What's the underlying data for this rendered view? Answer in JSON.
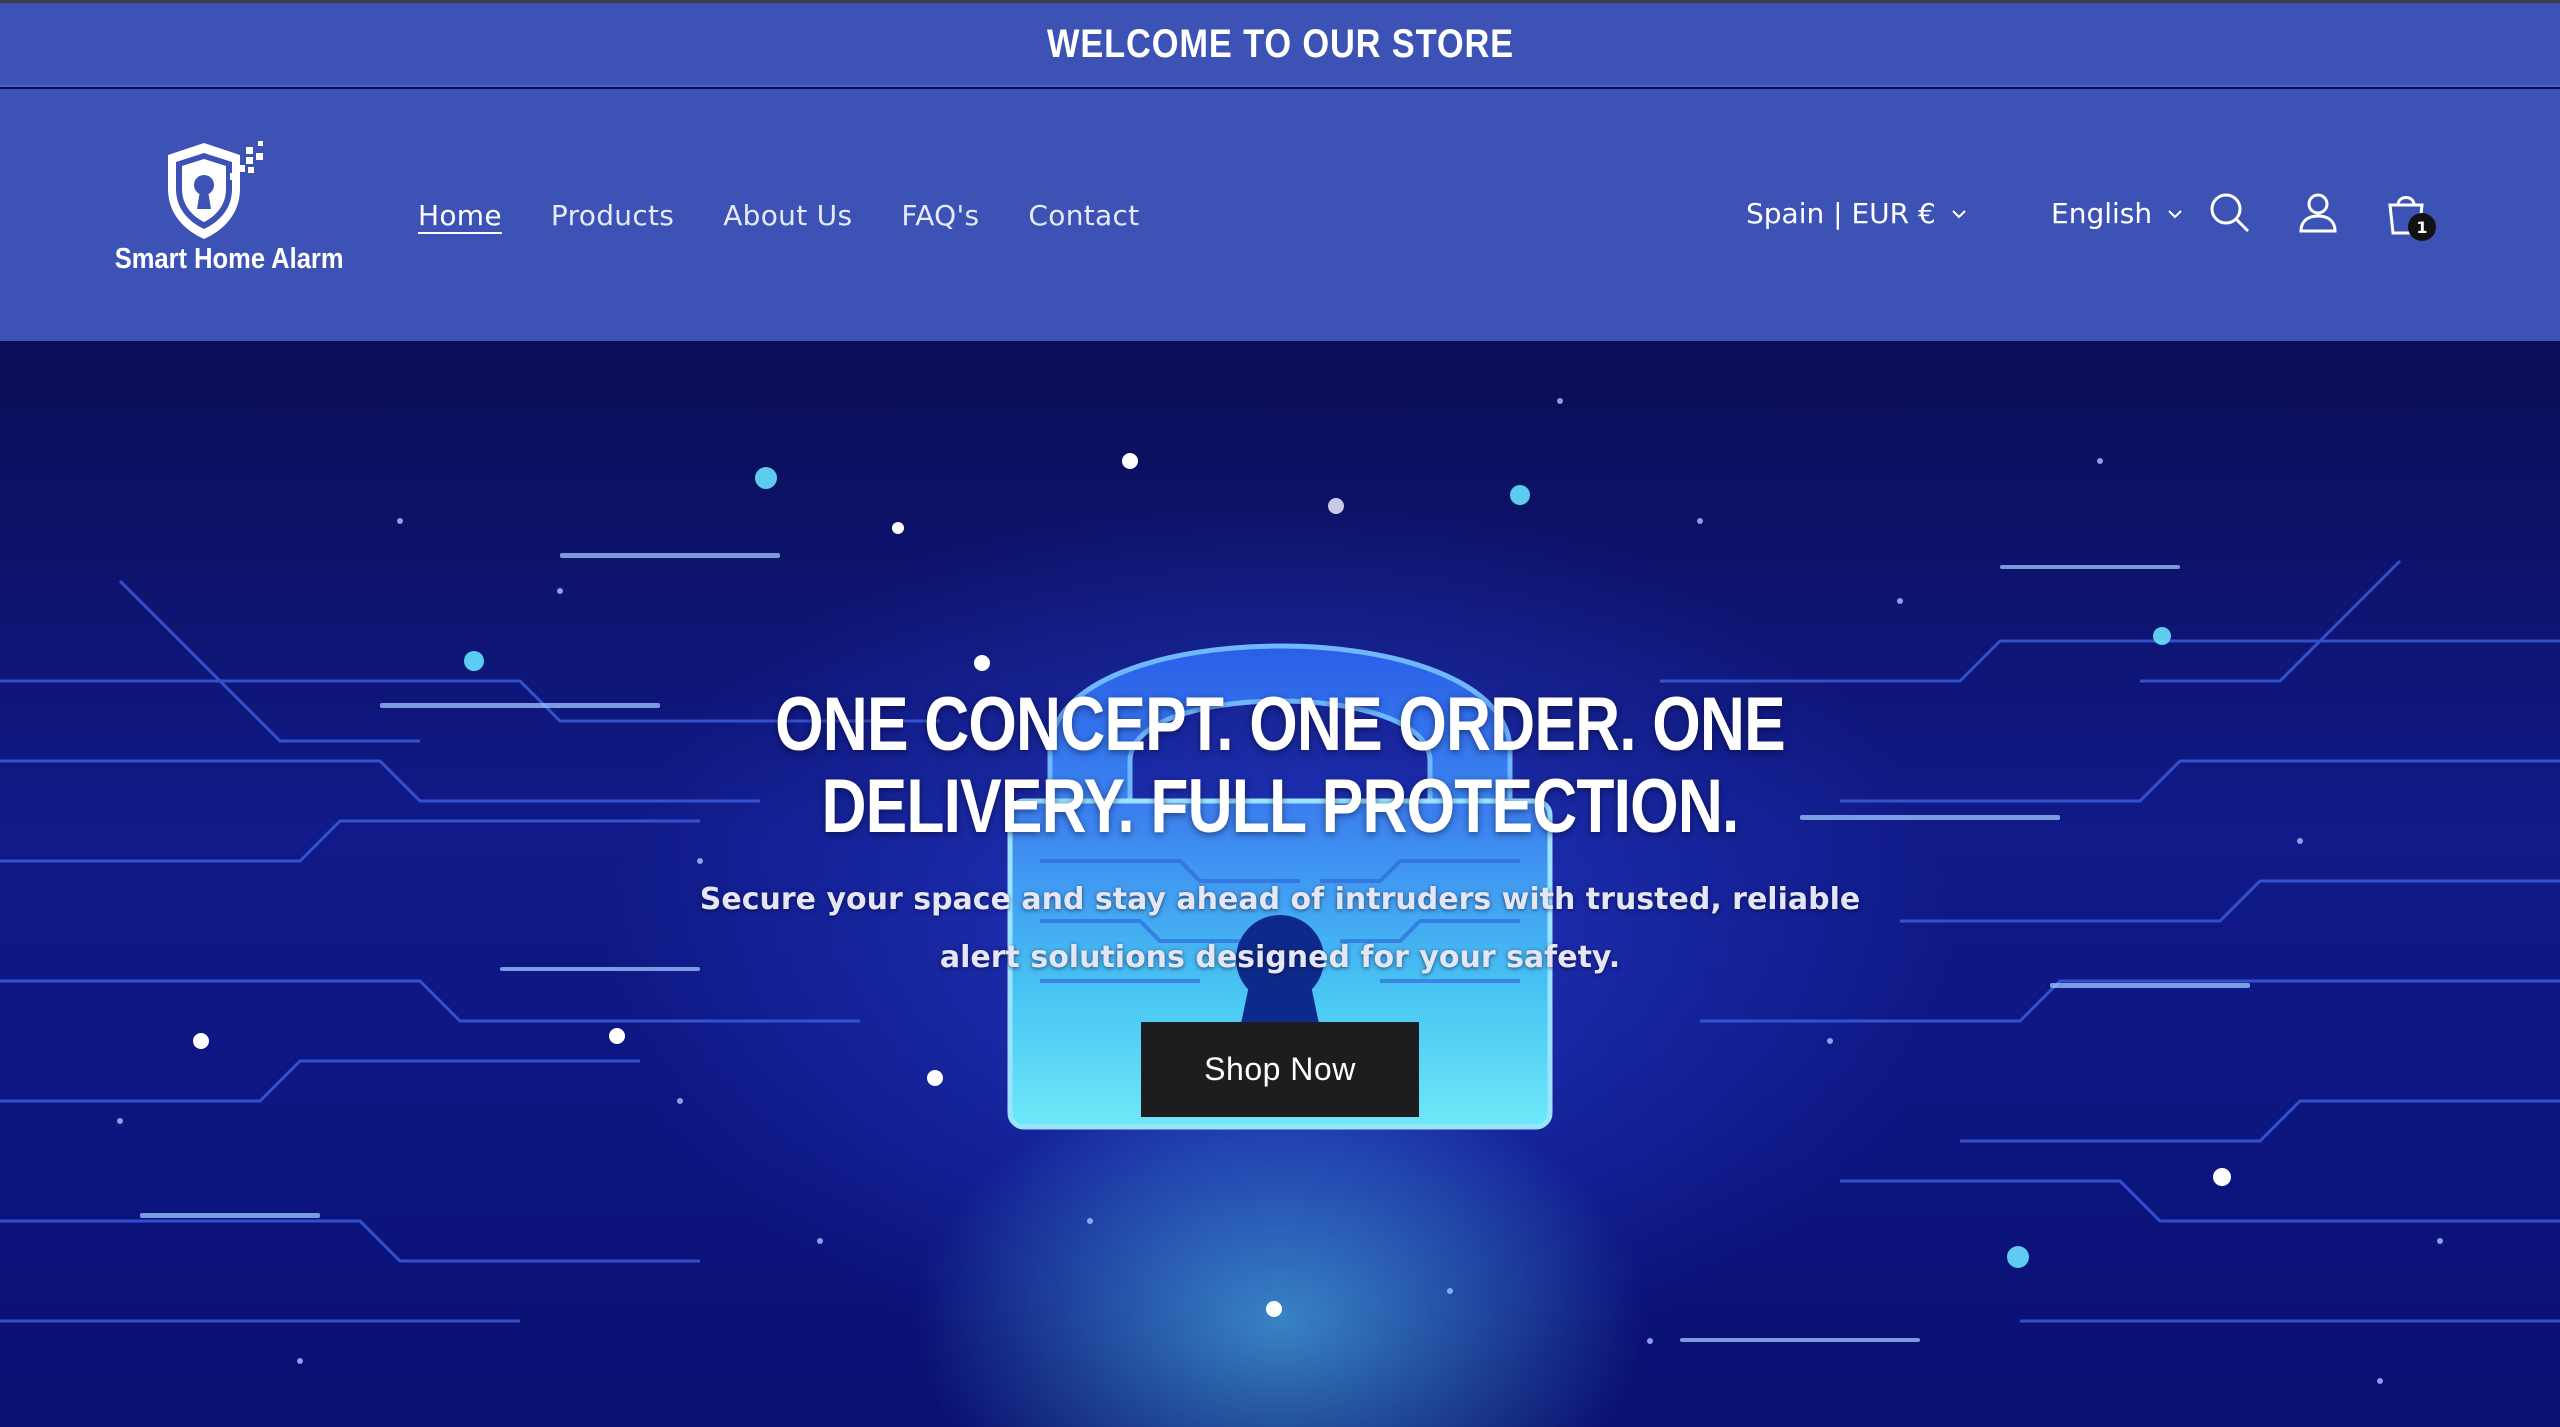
{
  "announcement": {
    "text": "WELCOME TO OUR STORE"
  },
  "logo": {
    "text": "Smart Home Alarm",
    "icon": "shield-keyhole-icon"
  },
  "nav": {
    "items": [
      {
        "label": "Home",
        "active": true
      },
      {
        "label": "Products",
        "active": false
      },
      {
        "label": "About Us",
        "active": false
      },
      {
        "label": "FAQ's",
        "active": false
      },
      {
        "label": "Contact",
        "active": false
      }
    ]
  },
  "header_tools": {
    "country_selector": "Spain | EUR €",
    "language_selector": "English",
    "search_icon": "search-icon",
    "account_icon": "account-icon",
    "cart_icon": "cart-icon",
    "cart_count": "1"
  },
  "hero": {
    "title_line1": "ONE CONCEPT. ONE ORDER. ONE",
    "title_line2": "DELIVERY. FULL PROTECTION.",
    "subtitle_line1": "Secure your space and stay ahead of intruders with trusted, reliable",
    "subtitle_line2": "alert solutions designed for your safety.",
    "cta_label": "Shop Now",
    "image_subject": "padlock-circuit-illustration"
  },
  "colors": {
    "header_bg": "#3c52b4",
    "hero_bg": "#0b0d55",
    "button_bg": "#1d1d1f",
    "text": "#ffffff"
  }
}
